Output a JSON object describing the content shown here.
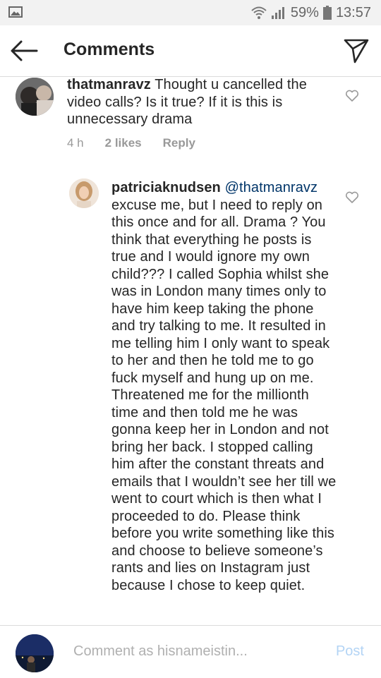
{
  "status_bar": {
    "battery": "59%",
    "time": "13:57"
  },
  "header": {
    "title": "Comments"
  },
  "comments": [
    {
      "username": "thatmanravz",
      "text": "Thought u cancelled the video calls? Is it true? If it is this is unnecessary drama",
      "time": "4 h",
      "likes": "2 likes",
      "reply": "Reply"
    },
    {
      "username": "patriciaknudsen",
      "mention": "@thatmanravz",
      "text": "excuse me, but I need to reply on this once and for all. Drama ? You think that everything he posts is true and I would ignore my own child??? I called Sophia whilst she was in London many times only to have him keep taking the phone and try talking to me. It resulted in me telling him I only want to speak to her and then he told me to go fuck myself and hung up on me. Threatened me for the millionth time and then told me he was gonna keep her in London and not bring her back. I stopped calling him after the constant threats and emails that I wouldn’t see her till we went to court which is then what I proceeded to do. Please think before you write something like this and choose to believe someone’s rants and lies on Instagram just because I chose to keep quiet."
    }
  ],
  "composer": {
    "placeholder": "Comment as hisnameistin...",
    "post_label": "Post"
  },
  "colors": {
    "mention": "#003569",
    "muted": "#999999",
    "post_disabled": "#b3d4f5"
  },
  "icons": [
    "gallery-icon",
    "wifi-icon",
    "signal-icon",
    "battery-icon",
    "back-arrow-icon",
    "send-icon",
    "heart-icon"
  ]
}
